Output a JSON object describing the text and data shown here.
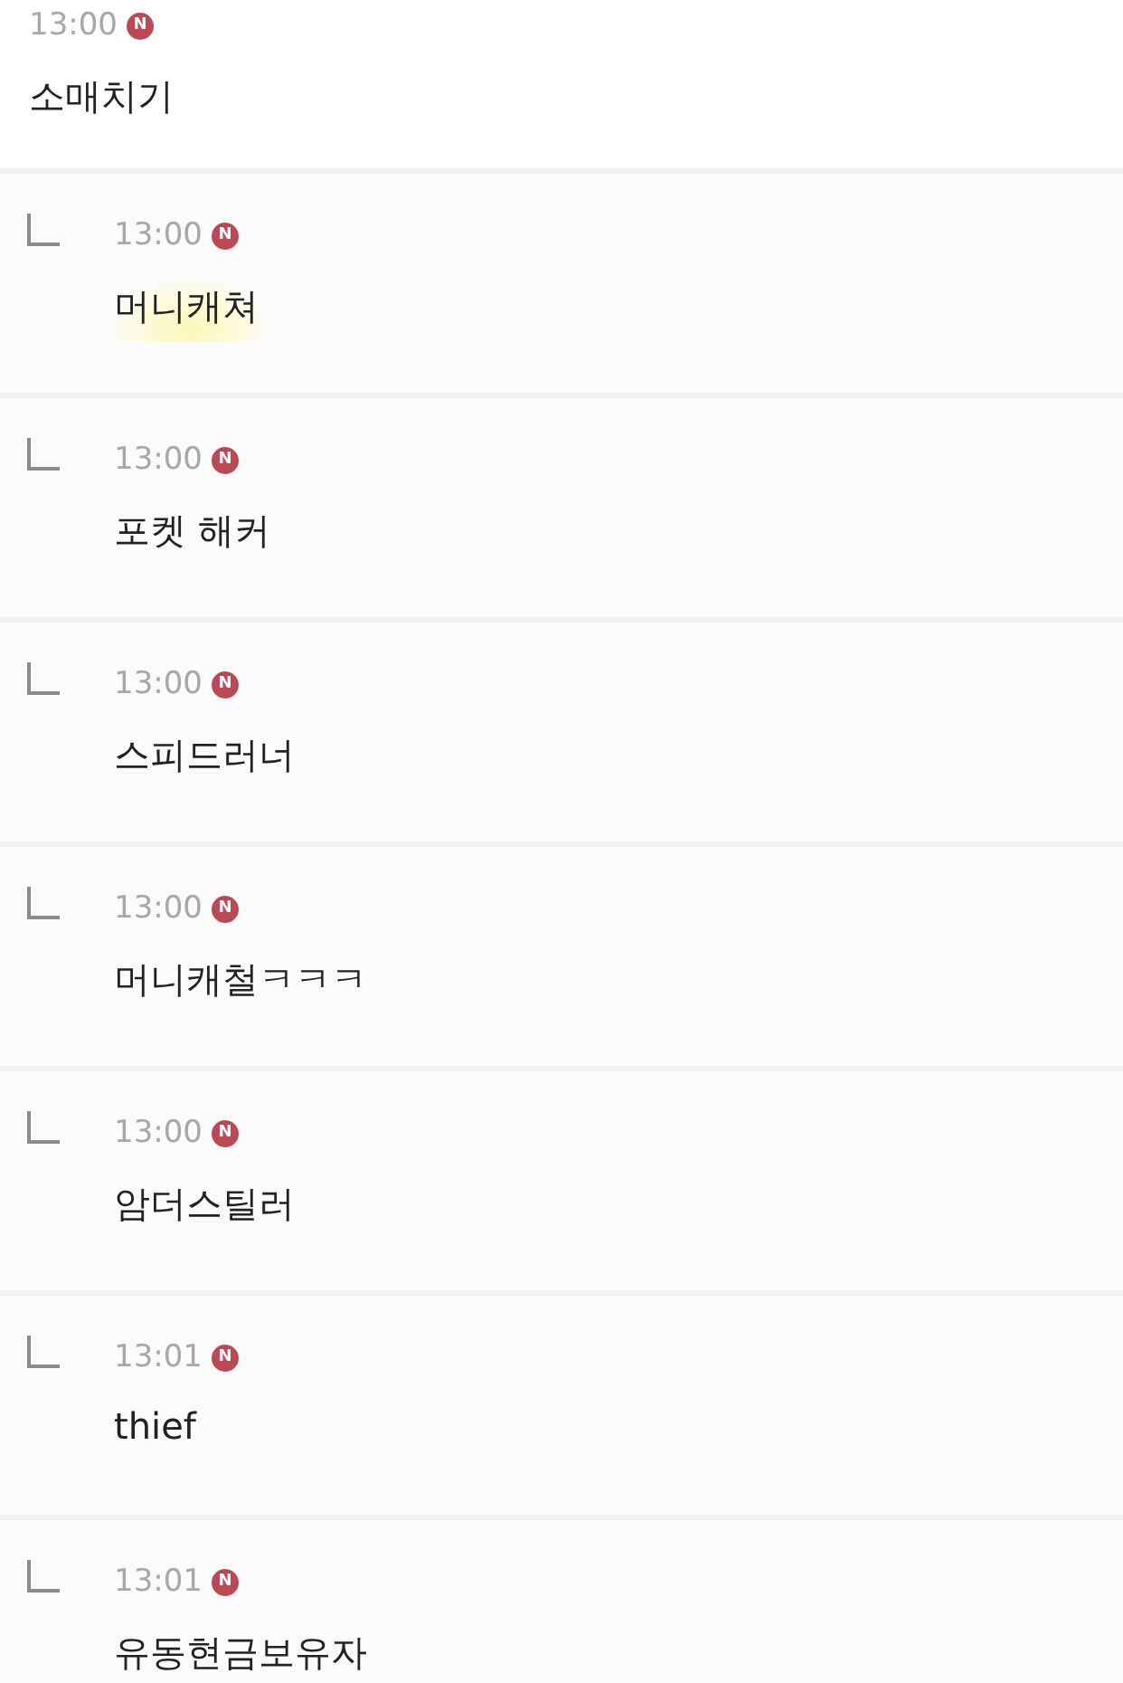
{
  "comment": {
    "time": "13:00",
    "badge": "N",
    "text": "소매치기"
  },
  "replies": [
    {
      "time": "13:00",
      "badge": "N",
      "text": "머니캐쳐",
      "highlighted": true
    },
    {
      "time": "13:00",
      "badge": "N",
      "text": "포켓 해커",
      "highlighted": false
    },
    {
      "time": "13:00",
      "badge": "N",
      "text": "스피드러너",
      "highlighted": false
    },
    {
      "time": "13:00",
      "badge": "N",
      "text": "머니캐철ㅋㅋㅋ",
      "highlighted": false
    },
    {
      "time": "13:00",
      "badge": "N",
      "text": "암더스틸러",
      "highlighted": false
    },
    {
      "time": "13:01",
      "badge": "N",
      "text": "thief",
      "highlighted": false
    },
    {
      "time": "13:01",
      "badge": "N",
      "text": "유동현금보유자",
      "highlighted": false
    }
  ]
}
